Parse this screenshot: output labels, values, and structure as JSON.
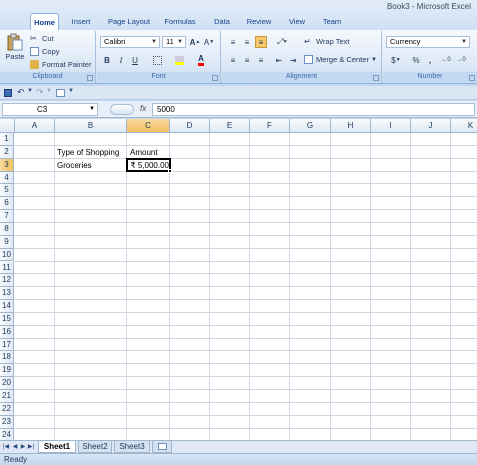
{
  "window": {
    "title": "Book3 - Microsoft Excel"
  },
  "ribbon": {
    "tabs": [
      "Home",
      "Insert",
      "Page Layout",
      "Formulas",
      "Data",
      "Review",
      "View",
      "Team"
    ],
    "active_tab": "Home",
    "clipboard": {
      "paste": "Paste",
      "cut": "Cut",
      "copy": "Copy",
      "format_painter": "Format Painter",
      "label": "Clipboard"
    },
    "font": {
      "name": "Calibri",
      "size": "11",
      "bold": "B",
      "italic": "I",
      "underline": "U",
      "label": "Font"
    },
    "alignment": {
      "wrap_text": "Wrap Text",
      "merge_center": "Merge & Center",
      "label": "Alignment"
    },
    "number": {
      "format": "Currency",
      "currency_symbol": "$",
      "percent": "%",
      "comma": ",",
      "label": "Number"
    }
  },
  "formula_bar": {
    "name_box": "C3",
    "fx": "fx",
    "content": "5000"
  },
  "sheet": {
    "columns": [
      "A",
      "B",
      "C",
      "D",
      "E",
      "F",
      "G",
      "H",
      "I",
      "J",
      "K"
    ],
    "rows": [
      "1",
      "2",
      "3",
      "4",
      "5",
      "6",
      "7",
      "8",
      "9",
      "10",
      "11",
      "12",
      "13",
      "14",
      "15",
      "16",
      "17",
      "18",
      "19",
      "20",
      "21",
      "22",
      "23",
      "24"
    ],
    "selected_column": "C",
    "selected_row": "3",
    "cells": {
      "B2": "Type of Shopping",
      "C2": "Amount",
      "B3": "Groceries",
      "C3": "₹ 5,000.00"
    }
  },
  "sheet_tabs": [
    "Sheet1",
    "Sheet2",
    "Sheet3"
  ],
  "active_sheet": "Sheet1",
  "status": {
    "text": "Ready"
  }
}
